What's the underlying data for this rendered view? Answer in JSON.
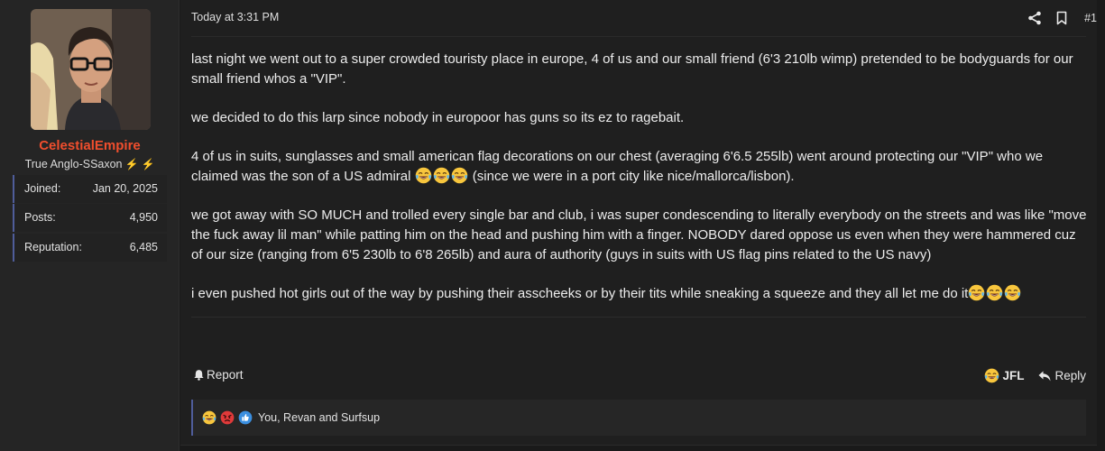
{
  "user": {
    "name": "CelestialEmpire",
    "title": "True Anglo-SSaxon",
    "title_icons": [
      "bolt-icon",
      "bolt-icon"
    ],
    "stats": [
      {
        "label": "Joined:",
        "value": "Jan 20, 2025"
      },
      {
        "label": "Posts:",
        "value": "4,950"
      },
      {
        "label": "Reputation:",
        "value": "6,485"
      }
    ]
  },
  "post": {
    "date": "Today at 3:31 PM",
    "number": "#1",
    "tools": [
      "share-icon",
      "bookmark-icon"
    ],
    "paragraphs": [
      {
        "text": "last night we went out to a super crowded touristy place in europe, 4 of us and our small friend (6'3 210lb wimp) pretended to be bodyguards for our small friend whos a \"VIP\"."
      },
      {
        "text": "we decided to do this larp since nobody in europoor has guns so its ez to ragebait."
      },
      {
        "text_a": "4 of us in suits, sunglasses and small american flag decorations on our chest (averaging 6'6.5 255lb) went around protecting our \"VIP\" who we claimed was the son of a US admiral ",
        "text_b": " (since we were in a port city like nice/mallorca/lisbon)."
      },
      {
        "text": "we got away with SO MUCH and trolled every single bar and club, i was super condescending to literally everybody on the streets and was like \"move the fuck away lil man\" while patting him on the head and pushing him with a finger. NOBODY dared oppose us even when they were hammered cuz of our size (ranging from 6'5 230lb to 6'8 265lb) and aura of authority (guys in suits with US flag pins related to the US navy)"
      },
      {
        "text": "i even pushed hot girls out of the way by pushing their asscheeks or by their tits while sneaking a squeeze and they all let me do it"
      }
    ],
    "emoji": "tears-of-joy-emoji"
  },
  "actions": {
    "report": "Report",
    "jfl": "JFL",
    "reply": "Reply"
  },
  "reactions": {
    "icons": [
      "tears-of-joy-emoji",
      "angry-emoji",
      "like-icon"
    ],
    "text": "You, Revan and Surfsup"
  },
  "colors": {
    "username": "#f04e2d",
    "accent_border": "#4f5d9a",
    "background": "#1a1a1a"
  }
}
